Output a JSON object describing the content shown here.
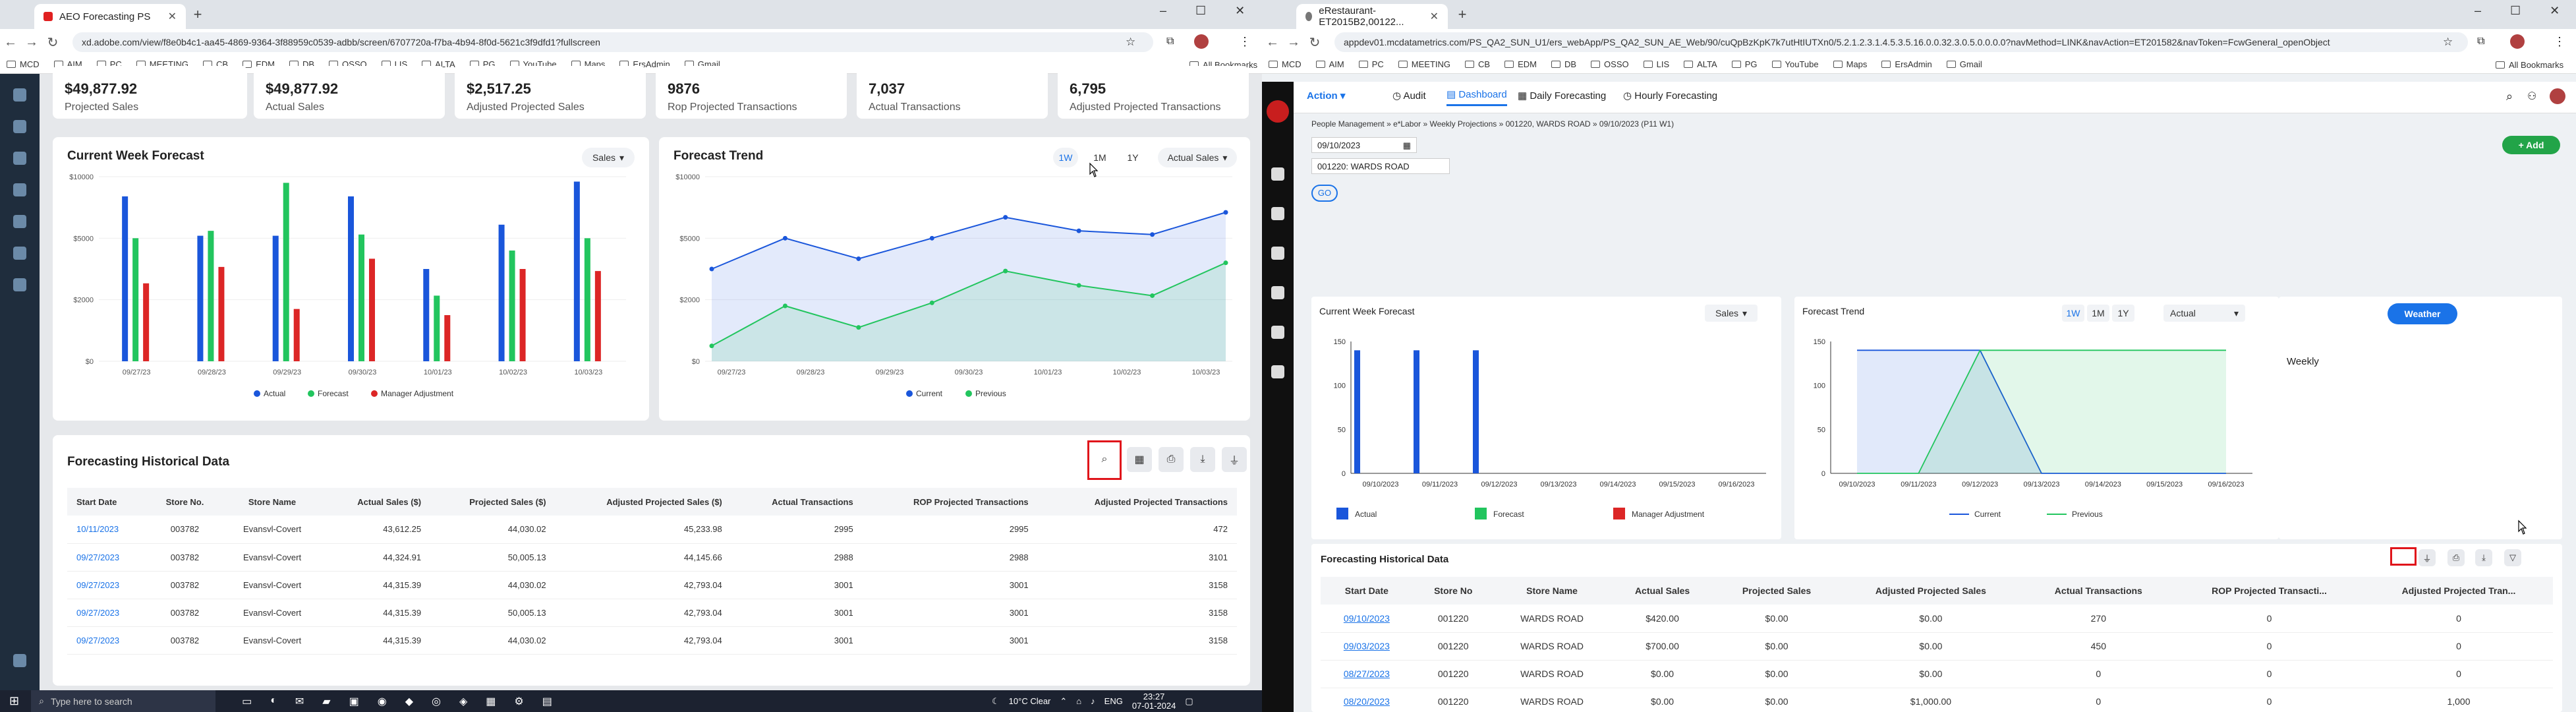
{
  "colors": {
    "blue": "#1a56db",
    "green": "#22c55e",
    "red": "#dc2626",
    "accent": "#1a73e8",
    "left_bg": "#e6e8eb",
    "right_bg": "#eef1f4"
  },
  "left_browser": {
    "tab_title": "AEO Forecasting PS",
    "url": "xd.adobe.com/view/f8e0b4c1-aa45-4869-9364-3f88959c0539-adbb/screen/6707720a-f7ba-4b94-8f0d-5621c3f9dfd1?fullscreen",
    "bookmarks": [
      "MCD",
      "AIM",
      "PC",
      "MEETING",
      "CB",
      "EDM",
      "DB",
      "OSSO",
      "LIS",
      "ALTA",
      "PG",
      "YouTube",
      "Maps",
      "ErsAdmin",
      "Gmail"
    ],
    "all_bookmarks": "All Bookmarks"
  },
  "kpis": [
    {
      "value": "$49,877.92",
      "label": "Projected Sales"
    },
    {
      "value": "$49,877.92",
      "label": "Actual Sales"
    },
    {
      "value": "$2,517.25",
      "label": "Adjusted Projected Sales"
    },
    {
      "value": "9876",
      "label": "Rop Projected Transactions"
    },
    {
      "value": "7,037",
      "label": "Actual Transactions"
    },
    {
      "value": "6,795",
      "label": "Adjusted Projected Transactions"
    }
  ],
  "left_cwf": {
    "title": "Current Week Forecast",
    "select": "Sales"
  },
  "left_ft": {
    "title": "Forecast Trend",
    "ranges": [
      "1W",
      "1M",
      "1Y"
    ],
    "select": "Actual Sales"
  },
  "left_hist": {
    "title": "Forecasting Historical Data",
    "headers": [
      "Start Date",
      "Store No.",
      "Store Name",
      "Actual Sales ($)",
      "Projected Sales ($)",
      "Adjusted Projected Sales ($)",
      "Actual  Transactions",
      "ROP Projected Transactions",
      "Adjusted Projected Transactions"
    ],
    "rows": [
      [
        "10/11/2023",
        "003782",
        "Evansvl-Covert",
        "43,612.25",
        "44,030.02",
        "45,233.98",
        "2995",
        "2995",
        "472"
      ],
      [
        "09/27/2023",
        "003782",
        "Evansvl-Covert",
        "44,324.91",
        "50,005.13",
        "44,145.66",
        "2988",
        "2988",
        "3101"
      ],
      [
        "09/27/2023",
        "003782",
        "Evansvl-Covert",
        "44,315.39",
        "44,030.02",
        "42,793.04",
        "3001",
        "3001",
        "3158"
      ],
      [
        "09/27/2023",
        "003782",
        "Evansvl-Covert",
        "44,315.39",
        "50,005.13",
        "42,793.04",
        "3001",
        "3001",
        "3158"
      ],
      [
        "09/27/2023",
        "003782",
        "Evansvl-Covert",
        "44,315.39",
        "44,030.02",
        "42,793.04",
        "3001",
        "3001",
        "3158"
      ]
    ]
  },
  "right_browser": {
    "tab_title": "eRestaurant-ET2015B2,00122...",
    "url": "appdev01.mcdatametrics.com/PS_QA2_SUN_U1/ers_webApp/PS_QA2_SUN_AE_Web/90/cuQpBzKpK7k7utHtIUTXn0/5.2.1.2.3.1.4.5.3.5.16.0.0.32.3.0.5.0.0.0.0?navMethod=LINK&navAction=ET201582&navToken=FcwGeneral_openObject",
    "bookmarks": [
      "MCD",
      "AIM",
      "PC",
      "MEETING",
      "CB",
      "EDM",
      "DB",
      "OSSO",
      "LIS",
      "ALTA",
      "PG",
      "YouTube",
      "Maps",
      "ErsAdmin",
      "Gmail"
    ],
    "all_bookmarks": "All Bookmarks"
  },
  "app": {
    "action": "Action",
    "nav": [
      "Audit",
      "Dashboard",
      "Daily Forecasting",
      "Hourly Forecasting"
    ],
    "breadcrumb": "People Management  »  e*Labor  »  Weekly Projections  »  001220, WARDS ROAD  »  09/10/2023 (P11 W1)",
    "date": "09/10/2023",
    "store": "001220: WARDS ROAD",
    "go": "GO",
    "add": "Add"
  },
  "right_cwf": {
    "title": "Current Week Forecast",
    "select": "Sales",
    "legend": [
      "Actual",
      "Forecast",
      "Manager Adjustment"
    ]
  },
  "right_ft": {
    "title": "Forecast Trend",
    "ranges": [
      "1W",
      "1M",
      "1Y"
    ],
    "select": "Actual",
    "legend": [
      "Current",
      "Previous"
    ]
  },
  "weather": {
    "button": "Weather",
    "label": "Weekly"
  },
  "right_hist": {
    "title": "Forecasting Historical Data",
    "headers": [
      "Start Date",
      "Store No",
      "Store Name",
      "Actual Sales",
      "Projected Sales",
      "Adjusted Projected Sales",
      "Actual Transactions",
      "ROP Projected Transacti...",
      "Adjusted Projected Tran..."
    ],
    "rows": [
      [
        "09/10/2023",
        "001220",
        "WARDS ROAD",
        "$420.00",
        "$0.00",
        "$0.00",
        "270",
        "0",
        "0"
      ],
      [
        "09/03/2023",
        "001220",
        "WARDS ROAD",
        "$700.00",
        "$0.00",
        "$0.00",
        "450",
        "0",
        "0"
      ],
      [
        "08/27/2023",
        "001220",
        "WARDS ROAD",
        "$0.00",
        "$0.00",
        "$0.00",
        "0",
        "0",
        "0"
      ],
      [
        "08/20/2023",
        "001220",
        "WARDS ROAD",
        "$0.00",
        "$0.00",
        "$1,000.00",
        "0",
        "0",
        "1,000"
      ]
    ]
  },
  "taskbar": {
    "search": "Type here to search",
    "weather": "10°C  Clear",
    "lang": "ENG",
    "time": "23:27",
    "date": "07-01-2024"
  },
  "chart_data": [
    {
      "type": "bar",
      "title": "Current Week Forecast",
      "categories": [
        "09/27/23",
        "09/28/23",
        "09/29/23",
        "09/30/23",
        "10/01/23",
        "10/02/23",
        "10/03/23"
      ],
      "ylim": [
        0,
        10000
      ],
      "yticks": [
        "$10000",
        "$5000",
        "$2000",
        "$0"
      ],
      "series": [
        {
          "name": "Actual",
          "values": [
            8400,
            5200,
            5200,
            8400,
            3500,
            6100,
            9600
          ]
        },
        {
          "name": "Forecast",
          "values": [
            5000,
            5600,
            9500,
            5300,
            2200,
            4400,
            5000
          ]
        },
        {
          "name": "Manager Adjustment",
          "values": [
            2800,
            3600,
            1700,
            4000,
            1500,
            3500,
            3400
          ]
        }
      ]
    },
    {
      "type": "area",
      "title": "Forecast Trend",
      "x": [
        "09/27/23",
        "09/28/23",
        "09/29/23",
        "09/30/23",
        "10/01/23",
        "10/02/23",
        "10/03/23"
      ],
      "ylim": [
        0,
        10000
      ],
      "yticks": [
        "$10000",
        "$5000",
        "$2000",
        "$0"
      ],
      "series": [
        {
          "name": "Current",
          "values": [
            3500,
            5000,
            4000,
            5000,
            6700,
            5600,
            5300,
            7100
          ]
        },
        {
          "name": "Previous",
          "values": [
            500,
            1800,
            1100,
            1900,
            3400,
            2700,
            2200,
            3800
          ]
        }
      ]
    },
    {
      "type": "bar",
      "title": "Current Week Forecast",
      "categories": [
        "09/10/2023",
        "09/11/2023",
        "09/12/2023",
        "09/13/2023",
        "09/14/2023",
        "09/15/2023",
        "09/16/2023"
      ],
      "ylim": [
        0,
        150
      ],
      "yticks": [
        "150",
        "100",
        "50",
        "0"
      ],
      "series": [
        {
          "name": "Actual",
          "values": [
            140,
            140,
            140,
            0,
            0,
            0,
            0
          ]
        },
        {
          "name": "Forecast",
          "values": [
            0,
            0,
            0,
            0,
            0,
            0,
            0
          ]
        },
        {
          "name": "Manager Adjustment",
          "values": [
            0,
            0,
            0,
            0,
            0,
            0,
            0
          ]
        }
      ]
    },
    {
      "type": "area",
      "title": "Forecast Trend",
      "x": [
        "09/10/2023",
        "09/11/2023",
        "09/12/2023",
        "09/13/2023",
        "09/14/2023",
        "09/15/2023",
        "09/16/2023"
      ],
      "ylim": [
        0,
        150
      ],
      "yticks": [
        "150",
        "100",
        "50",
        "0"
      ],
      "series": [
        {
          "name": "Current",
          "values": [
            140,
            140,
            140,
            0,
            0,
            0,
            0
          ]
        },
        {
          "name": "Previous",
          "values": [
            0,
            0,
            140,
            140,
            140,
            140,
            140
          ]
        }
      ]
    }
  ]
}
